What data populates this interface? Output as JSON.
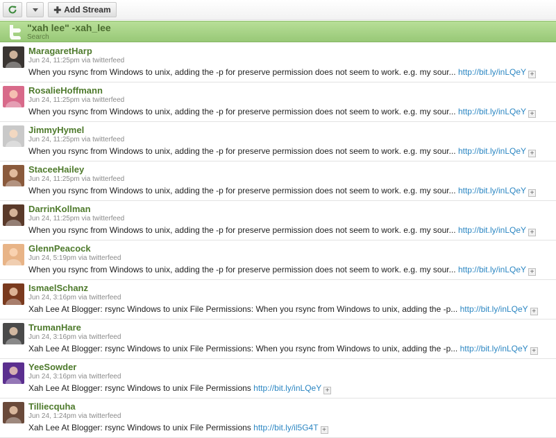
{
  "toolbar": {
    "add_stream_label": "Add Stream"
  },
  "stream": {
    "title": "\"xah lee\" -xah_lee",
    "subtitle": "Search"
  },
  "tweets": [
    {
      "user": "MaragaretHarp",
      "meta": "Jun 24, 11:25pm via twitterfeed",
      "text": "When you rsync from Windows to unix, adding the -p for preserve permission does not seem to work. e.g. my sour...",
      "link": "http://bit.ly/inLQeY",
      "avatar_color": "#3a3532"
    },
    {
      "user": "RosalieHoffmann",
      "meta": "Jun 24, 11:25pm via twitterfeed",
      "text": "When you rsync from Windows to unix, adding the -p for preserve permission does not seem to work. e.g. my sour...",
      "link": "http://bit.ly/inLQeY",
      "avatar_color": "#d86a8a"
    },
    {
      "user": "JimmyHymel",
      "meta": "Jun 24, 11:25pm via twitterfeed",
      "text": "When you rsync from Windows to unix, adding the -p for preserve permission does not seem to work. e.g. my sour...",
      "link": "http://bit.ly/inLQeY",
      "avatar_color": "#c9c9c9"
    },
    {
      "user": "StaceeHailey",
      "meta": "Jun 24, 11:25pm via twitterfeed",
      "text": "When you rsync from Windows to unix, adding the -p for preserve permission does not seem to work. e.g. my sour...",
      "link": "http://bit.ly/inLQeY",
      "avatar_color": "#8a5a3c"
    },
    {
      "user": "DarrinKollman",
      "meta": "Jun 24, 11:25pm via twitterfeed",
      "text": "When you rsync from Windows to unix, adding the -p for preserve permission does not seem to work. e.g. my sour...",
      "link": "http://bit.ly/inLQeY",
      "avatar_color": "#5a3a2a"
    },
    {
      "user": "GlennPeacock",
      "meta": "Jun 24, 5:19pm via twitterfeed",
      "text": "When you rsync from Windows to unix, adding the -p for preserve permission does not seem to work. e.g. my sour...",
      "link": "http://bit.ly/inLQeY",
      "avatar_color": "#e8b487"
    },
    {
      "user": "IsmaelSchanz",
      "meta": "Jun 24, 3:16pm via twitterfeed",
      "text": "Xah Lee At Blogger: rsync Windows to unix File Permissions: When you rsync from Windows to unix, adding the -p...",
      "link": "http://bit.ly/inLQeY",
      "avatar_color": "#7a3a1e"
    },
    {
      "user": "TrumanHare",
      "meta": "Jun 24, 3:16pm via twitterfeed",
      "text": "Xah Lee At Blogger: rsync Windows to unix File Permissions: When you rsync from Windows to unix, adding the -p...",
      "link": "http://bit.ly/inLQeY",
      "avatar_color": "#4a4a4a"
    },
    {
      "user": "YeeSowder",
      "meta": "Jun 24, 3:16pm via twitterfeed",
      "text": "Xah Lee At Blogger: rsync Windows to unix File Permissions",
      "link": "http://bit.ly/inLQeY",
      "avatar_color": "#5b2f8f"
    },
    {
      "user": "Tilliecquha",
      "meta": "Jun 24, 1:24pm via twitterfeed",
      "text": "Xah Lee At Blogger: rsync Windows to unix File Permissions",
      "link": "http://bit.ly/il5G4T",
      "avatar_color": "#6a4a3a"
    }
  ]
}
